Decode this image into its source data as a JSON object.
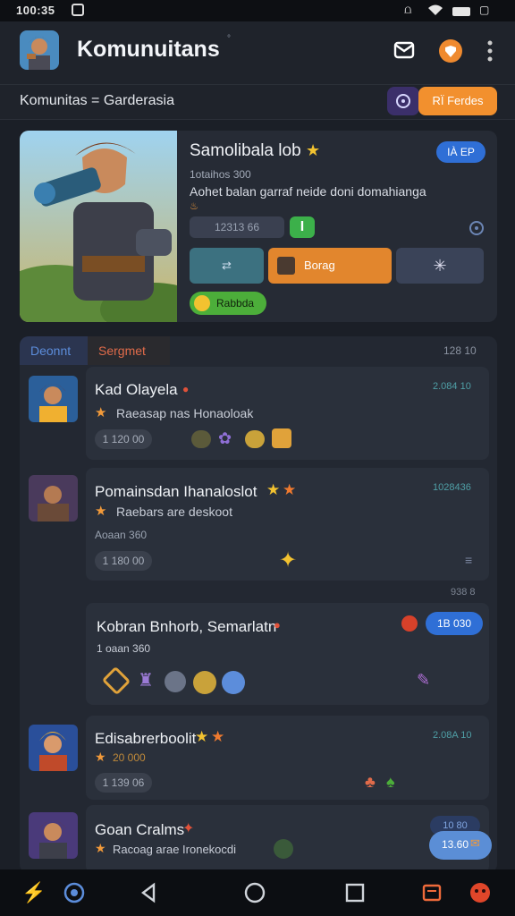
{
  "status": {
    "time": "100:35"
  },
  "appbar": {
    "title": "Komunuitans",
    "sup": "°"
  },
  "subbar": {
    "text": "Komunitas = Garderasia",
    "right_button": "RÏ Ferdes"
  },
  "hero": {
    "title": "Samolibala lob",
    "badge": "IÀ EP",
    "sub": "1otaihos 300",
    "desc": "Aohet balan garraf neide doni domahianga",
    "chip_value": "12313  66",
    "btn_center": "Borag",
    "tag": "Rabbda"
  },
  "list": {
    "tab_active": "Deonnt",
    "tab_2": "Sergmet",
    "tab_right": "128  10",
    "items": [
      {
        "title": "Kad Olayela",
        "sub": "Raeasap nas Honaoloak",
        "time": "2.084 10",
        "chip": "1 120  00"
      },
      {
        "title": "Pomainsdan Ihanaloslot",
        "sub": "Raebars are deskoot",
        "extra": "Aoaan 360",
        "time": "1028436",
        "chip": "1 180  00"
      },
      {
        "title": "Kobran Bnhorb, Semarlatn",
        "sub": "1 oaan 360",
        "time": "938 8",
        "badge": "1B 030"
      },
      {
        "title": "Edisabrerboolit",
        "sub": "20  000",
        "time": "2.08A 10",
        "chip": "1 139  06"
      },
      {
        "title": "Goan Cralms",
        "sub": "Racoag arae Ironekocdi",
        "badge": "10 80",
        "float_badge": "13.60"
      }
    ]
  },
  "colors": {
    "accent_blue": "#2f6fd6",
    "accent_orange": "#ef8a2f",
    "accent_green": "#4cae3a",
    "bg": "#1b1f27"
  }
}
